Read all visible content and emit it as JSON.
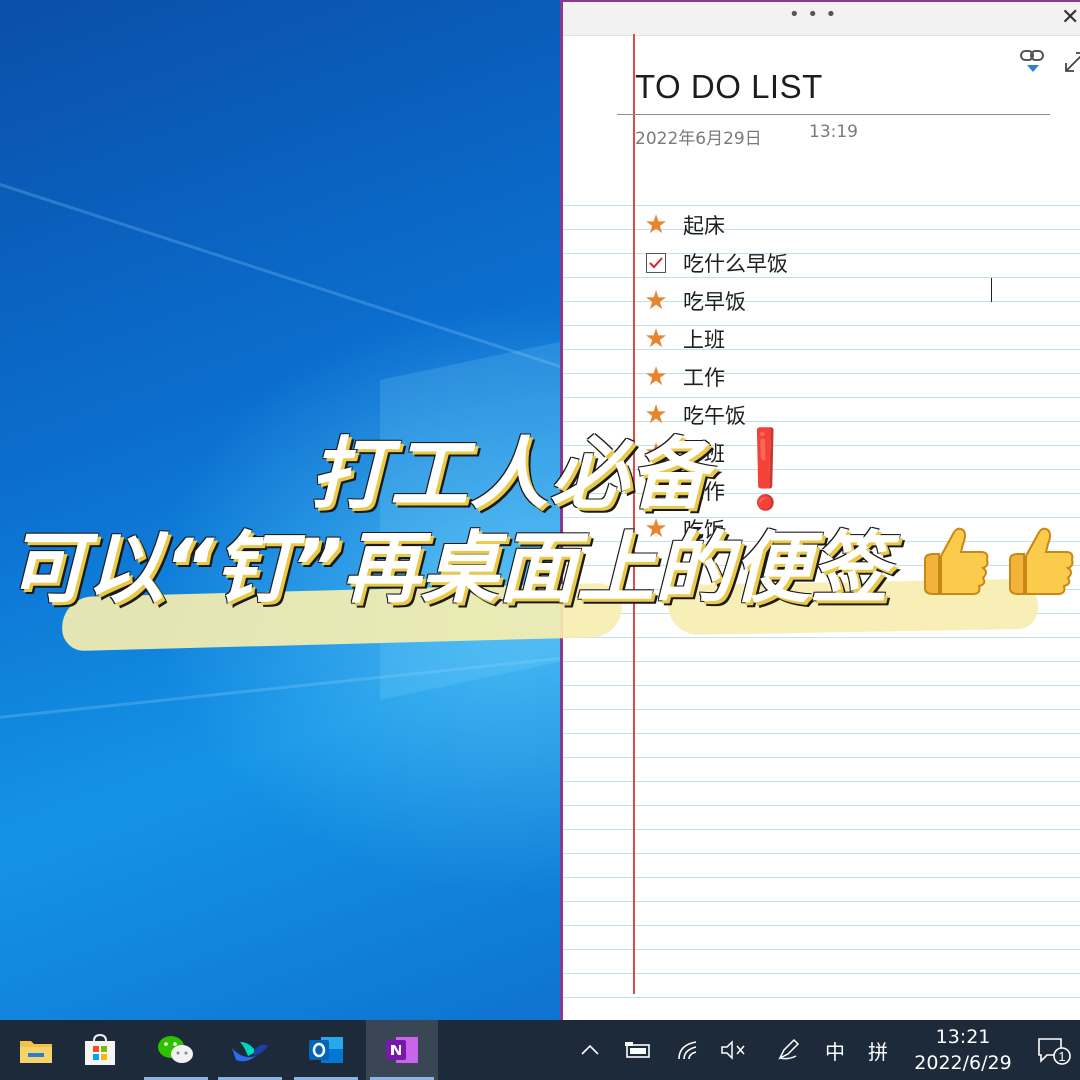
{
  "note": {
    "title": "TO DO LIST",
    "date": "2022年6月29日",
    "time": "13:19",
    "items": [
      {
        "marker": "star-icon",
        "text": "起床"
      },
      {
        "marker": "checkbox-checked",
        "text": "吃什么早饭"
      },
      {
        "marker": "star-icon",
        "text": "吃早饭"
      },
      {
        "marker": "star-icon",
        "text": "上班"
      },
      {
        "marker": "star-icon",
        "text": "工作"
      },
      {
        "marker": "star-icon",
        "text": "吃午饭"
      },
      {
        "marker": "star-icon",
        "text": "下班"
      },
      {
        "marker": "star-icon",
        "text": "工作"
      },
      {
        "marker": "star-icon",
        "text": "吃饭"
      }
    ]
  },
  "caption": {
    "line1": "打工人必备",
    "line2": "可以“钉”再桌面上的便签",
    "exclaim": "❗"
  },
  "taskbar": {
    "apps": [
      "file-explorer-icon",
      "microsoft-store-icon",
      "wechat-icon",
      "feishu-icon",
      "outlook-icon",
      "onenote-icon"
    ],
    "tray": {
      "ime_mode": "中",
      "ime_type": "拼",
      "notification_count": "1"
    },
    "clock_time": "13:21",
    "clock_date": "2022/6/29"
  },
  "colors": {
    "accent_purple": "#8a3b8f",
    "star_orange": "#e8842e",
    "margin_red": "#e0484a",
    "rule_blue": "#bfe2ee",
    "highlight_yellow": "#f7eeb0"
  }
}
